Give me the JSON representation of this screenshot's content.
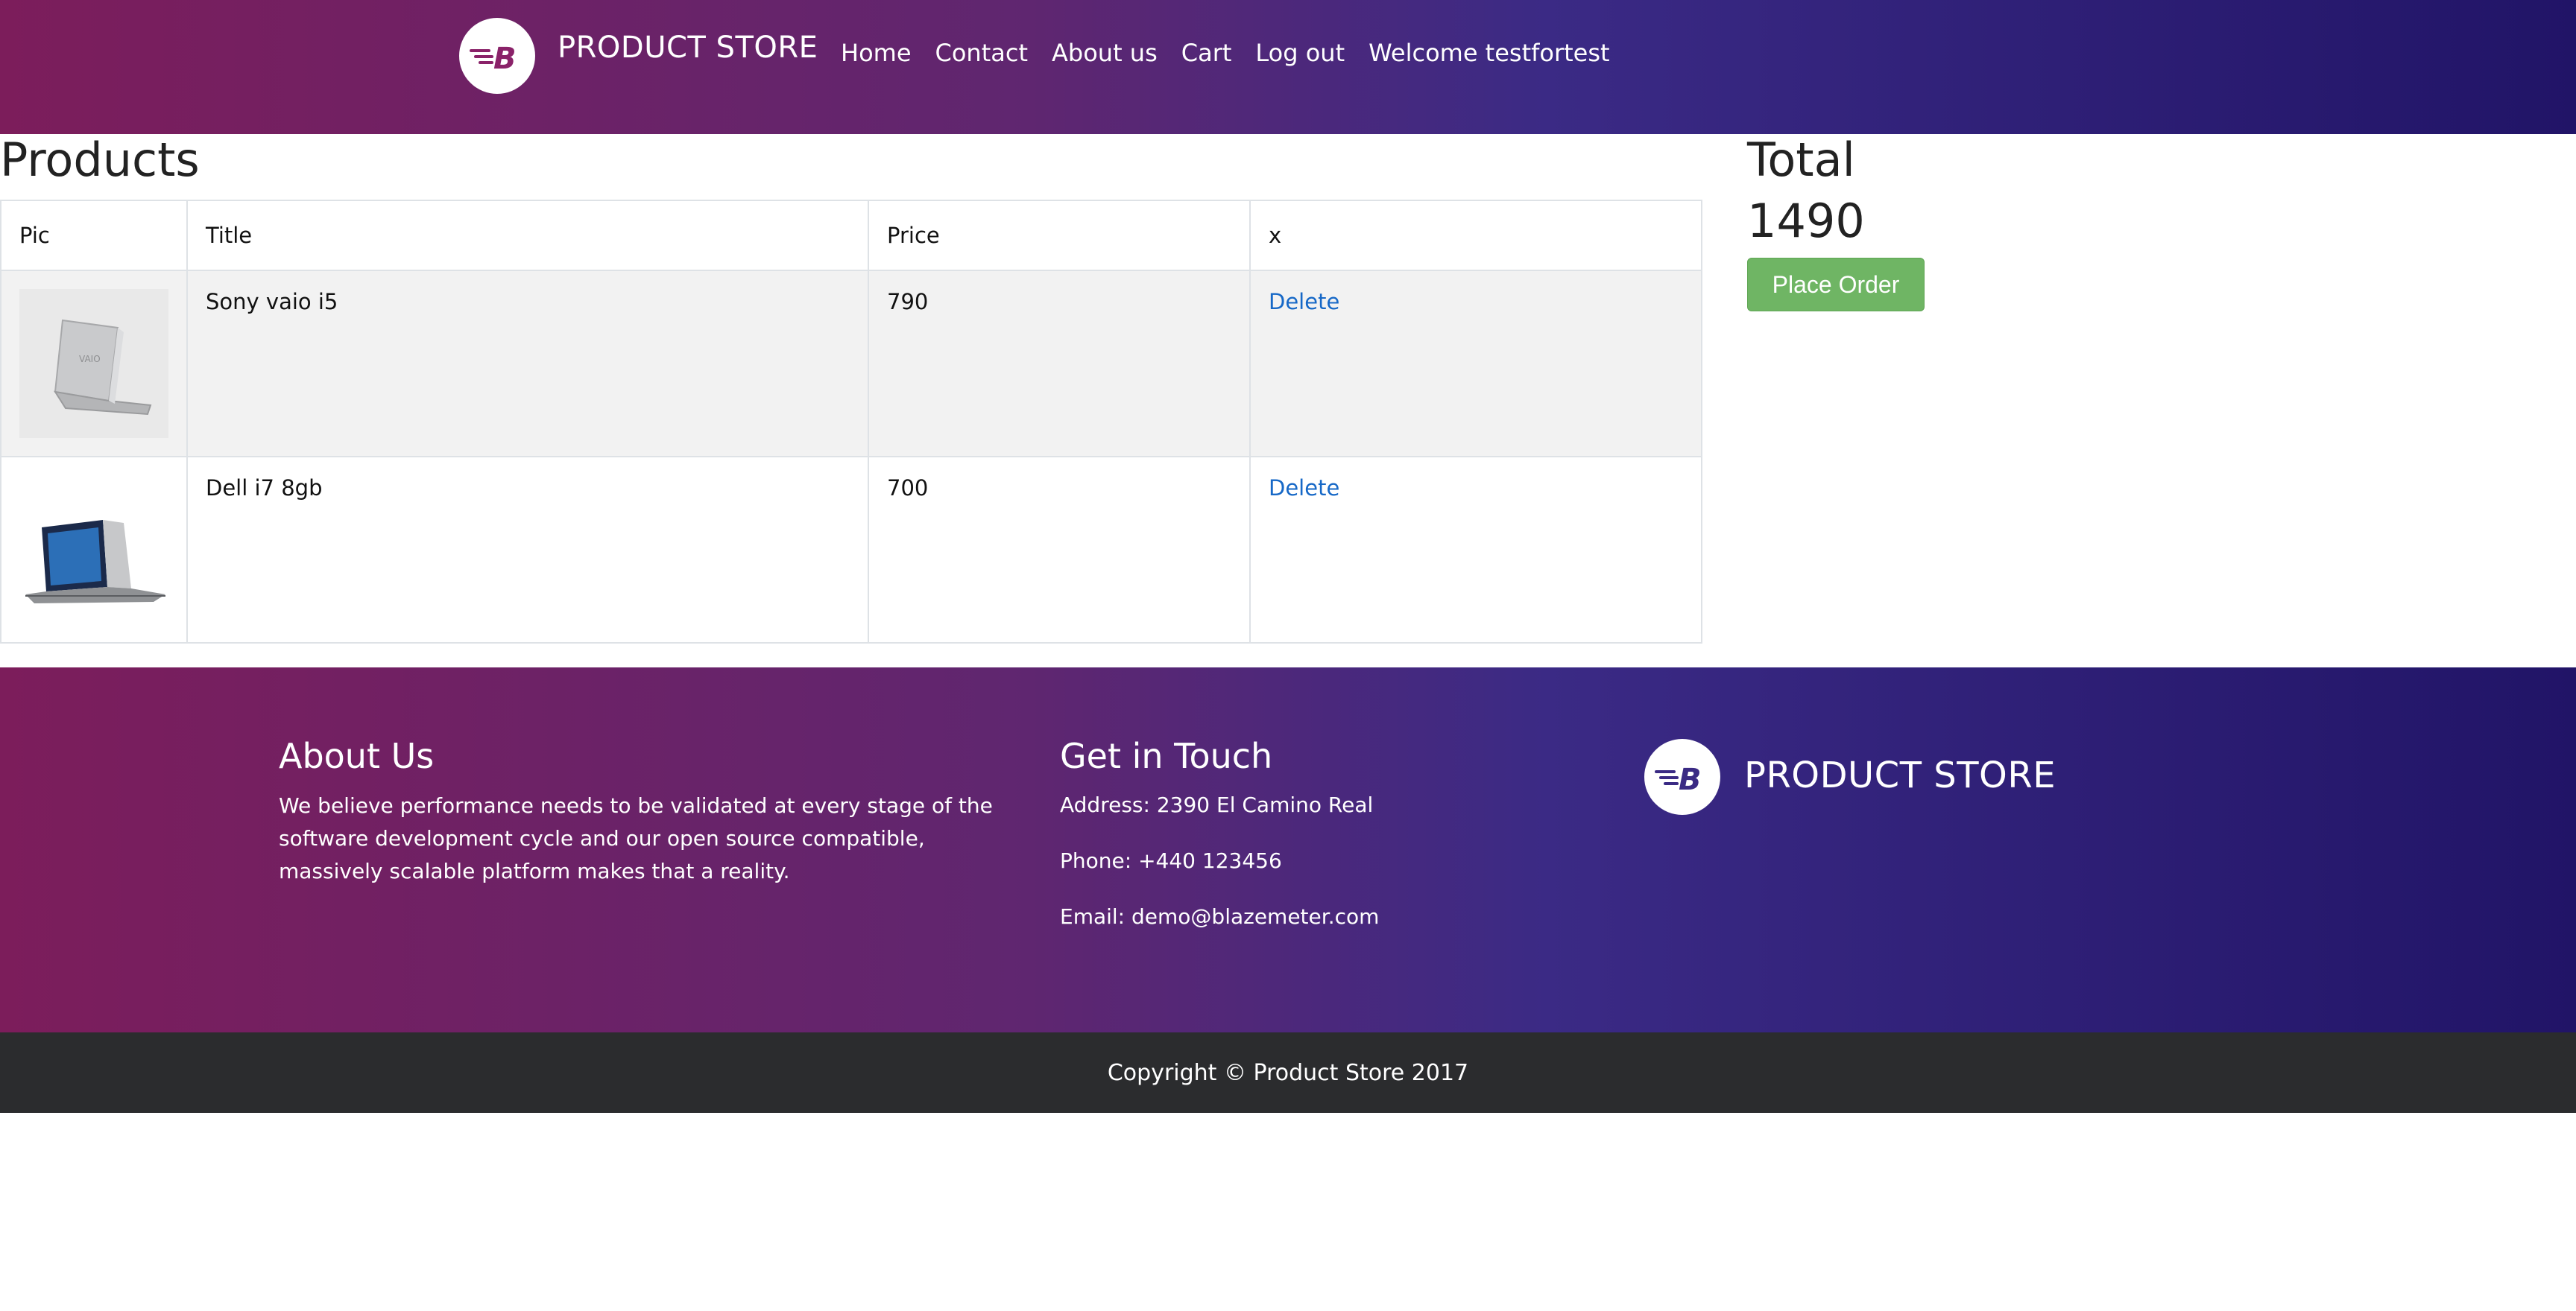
{
  "navbar": {
    "brand": "PRODUCT STORE",
    "links": [
      "Home",
      "Contact",
      "About us",
      "Cart",
      "Log out",
      "Welcome testfortest"
    ]
  },
  "products": {
    "heading": "Products",
    "columns": [
      "Pic",
      "Title",
      "Price",
      "x"
    ],
    "rows": [
      {
        "title": "Sony vaio i5",
        "price": "790",
        "action": "Delete"
      },
      {
        "title": "Dell i7 8gb",
        "price": "700",
        "action": "Delete"
      }
    ]
  },
  "summary": {
    "total_label": "Total",
    "total_value": "1490",
    "place_order": "Place Order"
  },
  "footer": {
    "about_title": "About Us",
    "about_text": "We believe performance needs to be validated at every stage of the software development cycle and our open source compatible, massively scalable platform makes that a reality.",
    "contact_title": "Get in Touch",
    "address": "Address: 2390 El Camino Real",
    "phone": "Phone: +440 123456",
    "email": "Email: demo@blazemeter.com",
    "brand": "PRODUCT STORE",
    "copyright": "Copyright © Product Store 2017"
  },
  "colors": {
    "gradient_start": "#7c1d5b",
    "gradient_end": "#211467",
    "order_button": "#6fb564",
    "link": "#1668c7",
    "copyright_bar": "#2b2c2e"
  },
  "icons": {
    "logo": "blazemeter-b-logo-icon",
    "product_1": "laptop-sony-vaio-image",
    "product_2": "laptop-dell-image"
  }
}
